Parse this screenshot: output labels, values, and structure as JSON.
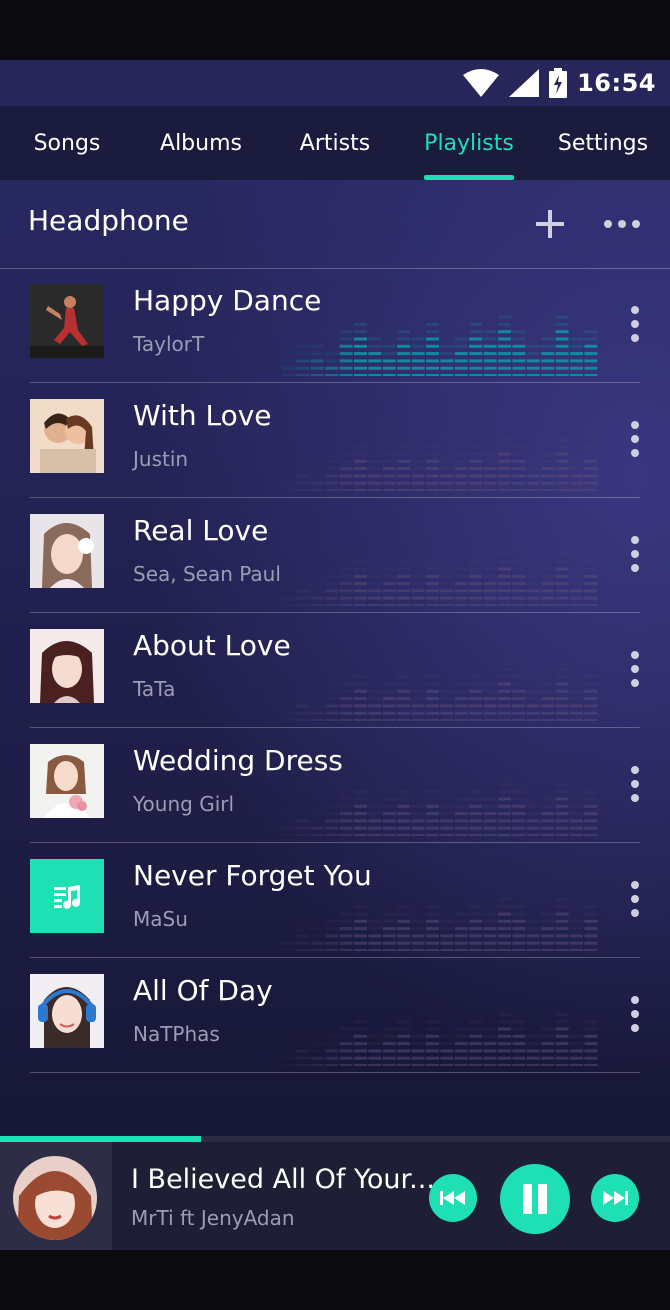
{
  "status": {
    "time": "16:54",
    "icons": [
      "wifi-icon",
      "cell-signal-icon",
      "battery-charging-icon"
    ]
  },
  "tabs": [
    {
      "label": "Songs",
      "active": false
    },
    {
      "label": "Albums",
      "active": false
    },
    {
      "label": "Artists",
      "active": false
    },
    {
      "label": "Playlists",
      "active": true
    },
    {
      "label": "Settings",
      "active": false
    }
  ],
  "header": {
    "title": "Headphone",
    "add_icon": "plus-icon",
    "more_icon": "more-horizontal-icon"
  },
  "songs": [
    {
      "title": "Happy Dance",
      "artist": "TaylorT",
      "playing": true
    },
    {
      "title": "With Love",
      "artist": "Justin",
      "playing": false
    },
    {
      "title": "Real Love",
      "artist": "Sea, Sean Paul",
      "playing": false
    },
    {
      "title": "About Love",
      "artist": "TaTa",
      "playing": false
    },
    {
      "title": "Wedding Dress",
      "artist": "Young Girl",
      "playing": false
    },
    {
      "title": "Never Forget You",
      "artist": "MaSu",
      "playing": false
    },
    {
      "title": "All Of Day",
      "artist": "NaTPhas",
      "playing": false
    }
  ],
  "player": {
    "title": "I Believed All Of Your...",
    "artist": "MrTi ft JenyAdan",
    "progress": 0.3,
    "controls": [
      "previous-icon",
      "pause-icon",
      "next-icon"
    ]
  },
  "colors": {
    "accent": "#1fe0b5",
    "background": "#232355",
    "tabbar": "#1b1b3d",
    "eq_active": "#0f8fa0",
    "eq_idle": "#5a4a78"
  }
}
